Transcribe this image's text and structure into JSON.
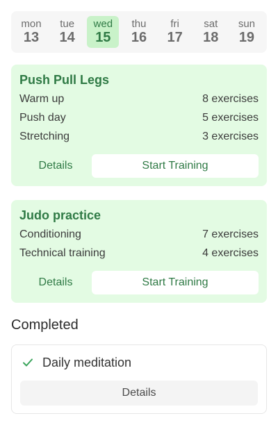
{
  "week": {
    "days": [
      {
        "name": "mon",
        "date": "13"
      },
      {
        "name": "tue",
        "date": "14"
      },
      {
        "name": "wed",
        "date": "15"
      },
      {
        "name": "thu",
        "date": "16"
      },
      {
        "name": "fri",
        "date": "17"
      },
      {
        "name": "sat",
        "date": "18"
      },
      {
        "name": "sun",
        "date": "19"
      }
    ],
    "selected": "wed"
  },
  "workouts": [
    {
      "title": "Push Pull Legs",
      "items": [
        {
          "label": "Warm up",
          "count": "8 exercises"
        },
        {
          "label": "Push day",
          "count": "5 exercises"
        },
        {
          "label": "Stretching",
          "count": "3 exercises"
        }
      ],
      "details_label": "Details",
      "start_label": "Start Training"
    },
    {
      "title": "Judo practice",
      "items": [
        {
          "label": "Conditioning",
          "count": "7 exercises"
        },
        {
          "label": "Technical training",
          "count": "4 exercises"
        }
      ],
      "details_label": "Details",
      "start_label": "Start Training"
    }
  ],
  "completed": {
    "section_title": "Completed",
    "items": [
      {
        "title": "Daily meditation",
        "details_label": "Details"
      }
    ]
  },
  "colors": {
    "accent": "#2f7a45",
    "card_bg": "#e3fbe3",
    "selected_day_bg": "#c9f2c9",
    "check": "#3aa45b"
  }
}
